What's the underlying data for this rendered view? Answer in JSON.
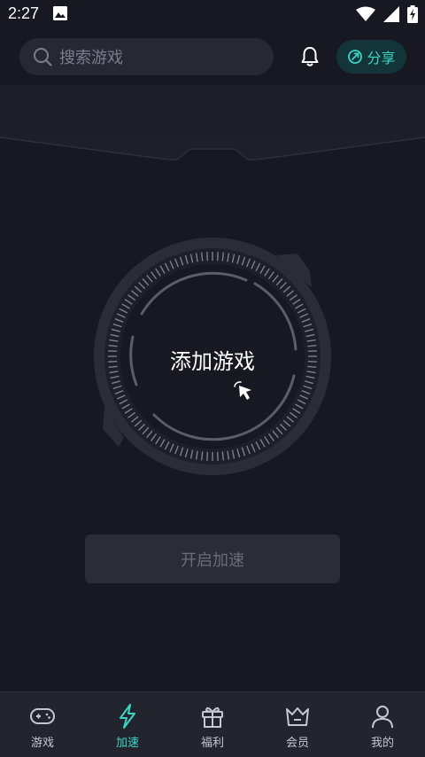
{
  "status_bar": {
    "time": "2:27"
  },
  "header": {
    "search_placeholder": "搜索游戏",
    "share_label": "分享"
  },
  "dial": {
    "label": "添加游戏"
  },
  "start_button": {
    "label": "开启加速"
  },
  "nav": {
    "items": [
      {
        "label": "游戏",
        "icon": "gamepad-icon"
      },
      {
        "label": "加速",
        "icon": "lightning-icon",
        "active": true
      },
      {
        "label": "福利",
        "icon": "gift-icon"
      },
      {
        "label": "会员",
        "icon": "crown-icon"
      },
      {
        "label": "我的",
        "icon": "user-icon"
      }
    ]
  },
  "colors": {
    "background": "#171821",
    "accent": "#3cd5c2",
    "nav_background": "#23252e"
  }
}
